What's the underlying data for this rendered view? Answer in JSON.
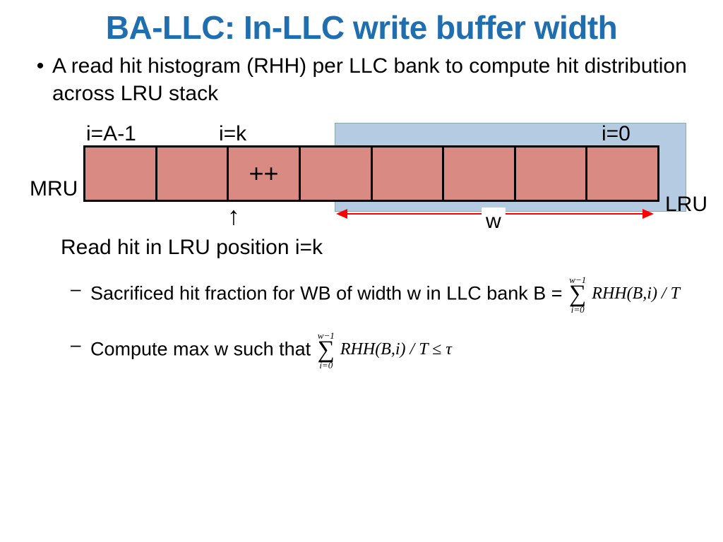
{
  "title": "BA-LLC: In-LLC write buffer width",
  "bullet1": "A read hit histogram (RHH) per LLC bank to compute hit distribution across LRU stack",
  "diagram": {
    "label_iA1": "i=A-1",
    "label_ik": "i=k",
    "label_i0": "i=0",
    "plusplus": "++",
    "mru": "MRU",
    "lru": "LRU",
    "w": "w",
    "caption": "Read hit in LRU position i=k",
    "cell_count": 8,
    "overlay_start_cell": 4
  },
  "sub1_prefix": "Sacrificed hit fraction for WB of width w in LLC bank B = ",
  "sub2_prefix": "Compute max w such that ",
  "eq": {
    "sum_top": "w−1",
    "sum_bot": "i=0",
    "body1": "RHH(B,i) / T",
    "body2": "RHH(B,i) / T ≤ τ"
  }
}
